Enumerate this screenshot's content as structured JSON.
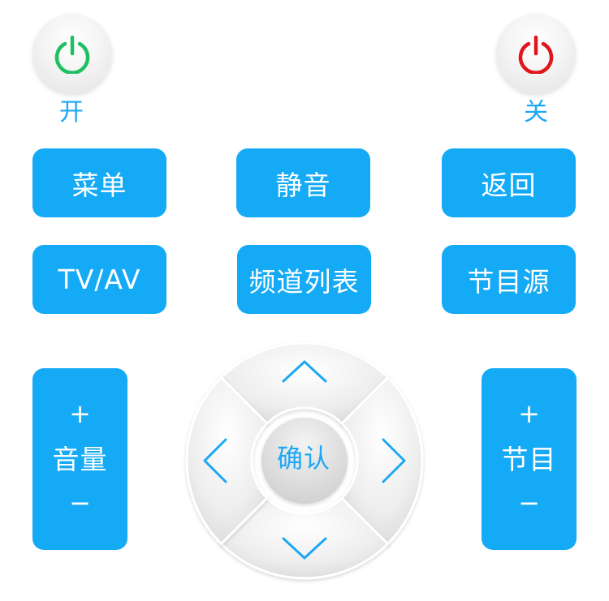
{
  "power": {
    "on_label": "开",
    "off_label": "关",
    "on_color": "#1fbf63",
    "off_color": "#e0161c",
    "on_icon": "power-icon",
    "off_icon": "power-icon"
  },
  "row1": {
    "menu": "菜单",
    "mute": "静音",
    "back": "返回"
  },
  "row2": {
    "tvav": "TV/AV",
    "channel_list": "频道列表",
    "source": "节目源"
  },
  "volume": {
    "plus": "+",
    "label": "音量",
    "minus": "−"
  },
  "channel": {
    "plus": "+",
    "label": "节目",
    "minus": "−"
  },
  "dpad": {
    "ok_label": "确认",
    "up_icon": "chevron-up-icon",
    "down_icon": "chevron-down-icon",
    "left_icon": "chevron-left-icon",
    "right_icon": "chevron-right-icon"
  },
  "colors": {
    "accent": "#14aaf5",
    "button_text": "#ffffff",
    "dpad_face": "#ececec"
  }
}
